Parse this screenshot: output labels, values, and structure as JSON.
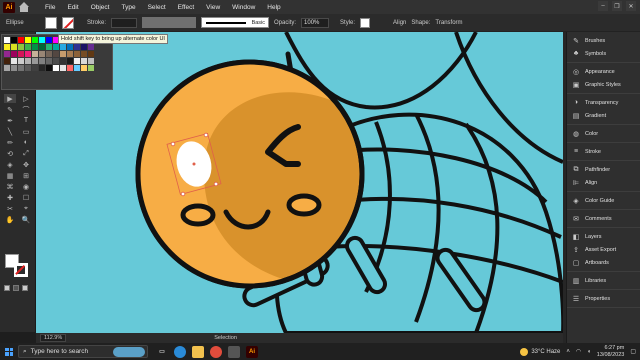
{
  "app": {
    "logo_text": "Ai"
  },
  "menu": [
    "File",
    "Edit",
    "Object",
    "Type",
    "Select",
    "Effect",
    "View",
    "Window",
    "Help"
  ],
  "window_controls": [
    "–",
    "❐",
    "✕"
  ],
  "control_bar": {
    "object_type": "Ellipse",
    "stroke_label": "Stroke:",
    "brush": "Basic",
    "opacity_label": "Opacity:",
    "opacity_value": "100%",
    "style_label": "Style:",
    "align": "Align",
    "shape": "Shape:",
    "transform": "Transform"
  },
  "tooltip": "Hold shift key to bring up alternate color UI",
  "tools": [
    "▶",
    "▷",
    "✎",
    "⌒",
    "✒",
    "T",
    "╲",
    "▭",
    "✏",
    "◐",
    "⟲",
    "⤢",
    "◈",
    "✥",
    "▦",
    "⊞",
    "⌘",
    "◉",
    "✚",
    "☐",
    "✂",
    "⌖",
    "✋",
    "🔍"
  ],
  "status": {
    "zoom": "112.9%",
    "selection": "Selection"
  },
  "panels": [
    {
      "group": [
        {
          "icon": "brush-icon",
          "label": "Brushes",
          "glyph": "✎"
        },
        {
          "icon": "symbols-icon",
          "label": "Symbols",
          "glyph": "♣"
        }
      ]
    },
    {
      "group": [
        {
          "icon": "appearance-icon",
          "label": "Appearance",
          "glyph": "◎"
        },
        {
          "icon": "graphic-styles-icon",
          "label": "Graphic Styles",
          "glyph": "▣"
        }
      ]
    },
    {
      "group": [
        {
          "icon": "transparency-icon",
          "label": "Transparency",
          "glyph": "◑"
        },
        {
          "icon": "gradient-icon",
          "label": "Gradient",
          "glyph": "▤"
        }
      ]
    },
    {
      "group": [
        {
          "icon": "color-icon",
          "label": "Color",
          "glyph": "◍"
        }
      ]
    },
    {
      "group": [
        {
          "icon": "stroke-icon",
          "label": "Stroke",
          "glyph": "≡"
        }
      ]
    },
    {
      "group": [
        {
          "icon": "pathfinder-icon",
          "label": "Pathfinder",
          "glyph": "⧉"
        },
        {
          "icon": "align-icon",
          "label": "Align",
          "glyph": "⊫"
        }
      ]
    },
    {
      "group": [
        {
          "icon": "color-guide-icon",
          "label": "Color Guide",
          "glyph": "◈"
        }
      ]
    },
    {
      "group": [
        {
          "icon": "comments-icon",
          "label": "Comments",
          "glyph": "✉"
        }
      ]
    },
    {
      "group": [
        {
          "icon": "layers-icon",
          "label": "Layers",
          "glyph": "◧"
        },
        {
          "icon": "asset-export-icon",
          "label": "Asset Export",
          "glyph": "⇪"
        },
        {
          "icon": "artboards-icon",
          "label": "Artboards",
          "glyph": "▢"
        }
      ]
    },
    {
      "group": [
        {
          "icon": "libraries-icon",
          "label": "Libraries",
          "glyph": "▥"
        }
      ]
    },
    {
      "group": [
        {
          "icon": "properties-icon",
          "label": "Properties",
          "glyph": "☰"
        }
      ]
    }
  ],
  "taskbar": {
    "search_placeholder": "Type here to search",
    "weather": "33°C  Haze",
    "time": "6:27 pm",
    "date": "13/08/2023"
  },
  "colors": {
    "canvas": "#66c9d8",
    "bee_head": "#f7ad45",
    "bee_head_shadow": "#d9922c",
    "accent": "#ff9a00"
  }
}
